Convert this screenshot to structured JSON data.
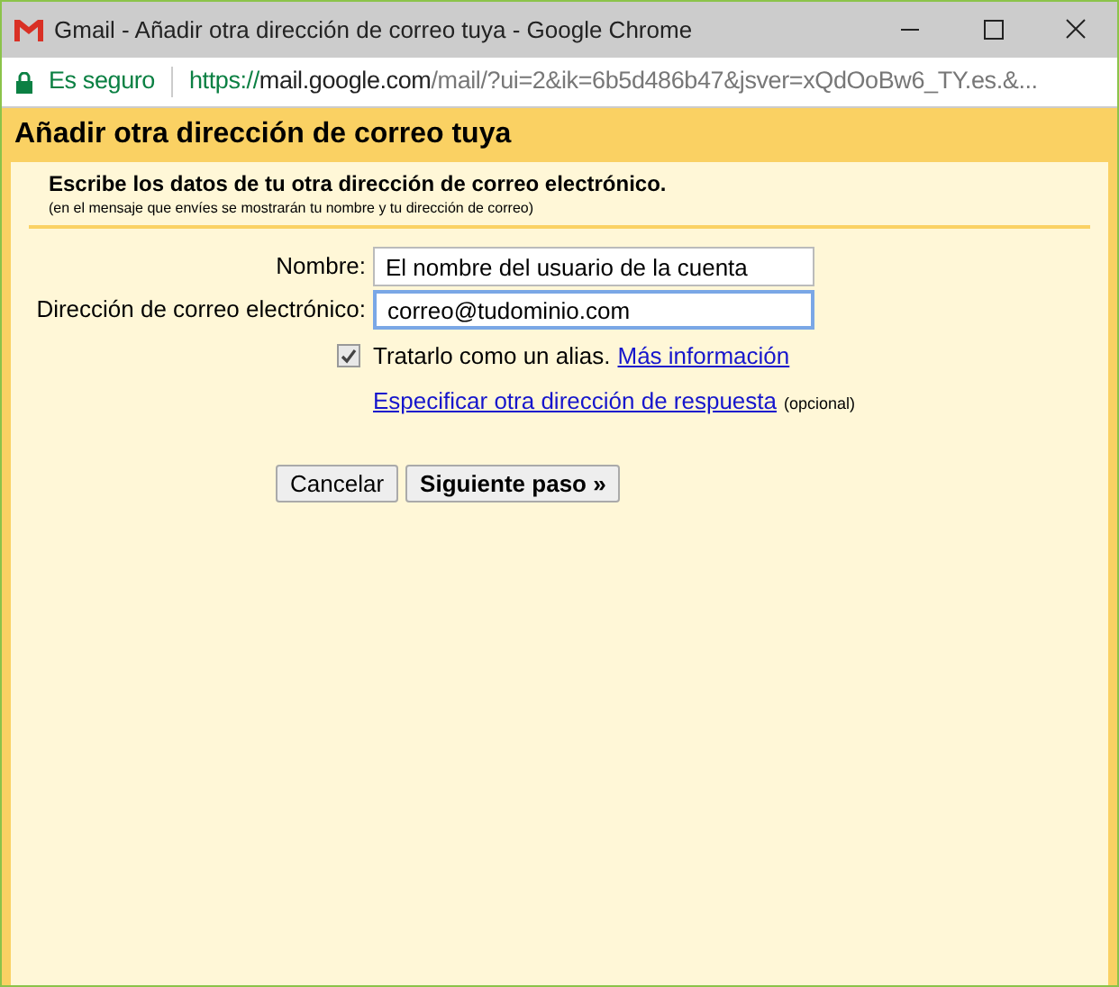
{
  "window": {
    "title": "Gmail - Añadir otra dirección de correo tuya - Google Chrome"
  },
  "address_bar": {
    "security": "Es seguro",
    "url_scheme": "https://",
    "url_host": "mail.google.com",
    "url_rest": "/mail/?ui=2&ik=6b5d486b47&jsver=xQdOoBw6_TY.es.&..."
  },
  "dialog": {
    "title": "Añadir otra dirección de correo tuya",
    "heading": "Escribe los datos de tu otra dirección de correo electrónico.",
    "subheading": "(en el mensaje que envíes se mostrarán tu nombre y tu dirección de correo)",
    "fields": [
      {
        "label": "Nombre:",
        "value": "El nombre del usuario de la cuenta",
        "focused": false
      },
      {
        "label": "Dirección de correo electrónico:",
        "value": "correo@tudominio.com",
        "focused": true
      }
    ],
    "alias": {
      "label": "Tratarlo como un alias.",
      "checked": true,
      "link": "Más información"
    },
    "reply_to": {
      "link": "Especificar otra dirección de respuesta",
      "note": "(opcional)"
    },
    "buttons": [
      {
        "label": "Cancelar",
        "primary": false
      },
      {
        "label": "Siguiente paso »",
        "primary": true
      }
    ]
  }
}
